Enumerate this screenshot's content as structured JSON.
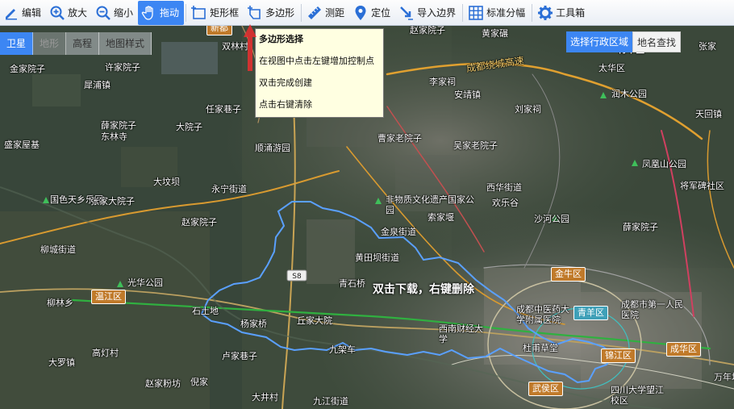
{
  "toolbar": {
    "items": [
      {
        "label": "编辑",
        "icon": "edit-icon"
      },
      {
        "label": "放大",
        "icon": "zoom-in-icon"
      },
      {
        "label": "缩小",
        "icon": "zoom-out-icon"
      },
      {
        "label": "拖动",
        "icon": "hand-icon",
        "active": true
      },
      {
        "label": "矩形框",
        "icon": "rectangle-icon"
      },
      {
        "label": "多边形",
        "icon": "polygon-icon"
      },
      {
        "label": "测距",
        "icon": "ruler-icon"
      },
      {
        "label": "定位",
        "icon": "location-pin-icon"
      },
      {
        "label": "导入边界",
        "icon": "import-boundary-icon"
      },
      {
        "label": "标准分幅",
        "icon": "grid-icon"
      },
      {
        "label": "工具箱",
        "icon": "gear-icon"
      }
    ]
  },
  "map_type": {
    "tabs": [
      {
        "label": "卫星",
        "selected": true
      },
      {
        "label": "地形",
        "disabled": true
      },
      {
        "label": "高程"
      },
      {
        "label": "地图样式"
      }
    ]
  },
  "region_tabs": {
    "select_region": "选择行政区域",
    "place_search": "地名查找"
  },
  "tooltip": {
    "title": "多边形选择",
    "lines": [
      "在视图中点击左键增加控制点",
      "双击完成创建",
      "点击右键清除"
    ]
  },
  "center_message": "双击下载，右键删除",
  "districts": {
    "wenjiang": "温江区",
    "jinniu": "金牛区",
    "qingyang": "青羊区",
    "jinjiang": "锦江区",
    "chenghua": "成华区",
    "wuhou": "武侯区",
    "xindu": "新都"
  },
  "places": {
    "jinjia_yuanzi": "金家院子",
    "xujia_yuanzi": "许家院子",
    "liliu": "犀浦镇",
    "xuejia_yuanzi": "薛家院子",
    "dongqiao": "东林寺",
    "dayuanzi": "大院子",
    "renjia_xiangzi": "任家巷子",
    "shuanglin": "双林村",
    "sheng": "盛家屋基",
    "anjing": "安靖镇",
    "shuncheng": "顺涌游园",
    "dabaoba": "大坟坝",
    "caojia": "曹家老院子",
    "lijiajia": "李家祠",
    "liujiaci": "刘家祠",
    "wujia": "吴家老院子",
    "huangjia": "黄家碾",
    "taiyang": "太华区",
    "runmu": "润木公园",
    "tianhui": "天回镇",
    "fenghuang": "凤凰山公园",
    "jiangjun": "将军碑社区",
    "guose": "国色天乡乐园",
    "zhangjia": "张家大院子",
    "yongning": "永宁街道",
    "feiwuzhi": "非物质文化遗产国家公园",
    "jinquan": "金泉街道",
    "suojia": "索家堰",
    "xihua": "西华街道",
    "huanle": "欢乐谷",
    "shahe": "沙河公园",
    "xuejiayuan": "薛家院子",
    "liucheng": "柳城街道",
    "guanghua": "光华公园",
    "huangtian": "黄田坝街道",
    "qingshi": "青石桥",
    "liulin": "柳林乡",
    "shitu": "石土地",
    "yangjia": "杨家桥",
    "qiujia": "丘家大院",
    "xinan": "西南财经大学",
    "zhonggong": "成都中医药大学附属医院",
    "renmin": "成都市第一人民医院",
    "dufu": "杜甫草堂",
    "jiujia": "九架车",
    "luojia": "卢家巷子",
    "dalu": "大罗镇",
    "gaodeng": "高灯村",
    "zhaojia": "赵家粉坊",
    "niyan": "倪家",
    "dajing": "大井村",
    "jiuqiao": "九江街道",
    "sichuan": "四川大学望江校区",
    "chengdu_ring": "成都绕城高速",
    "zhaojiayuan": "赵家院子",
    "zhang": "张家",
    "qingyang_top": "青羊区",
    "wanyuan": "万年场",
    "zhangjia_right": "张家"
  },
  "roads": {
    "s8": "S8"
  },
  "colors": {
    "accent": "#3c86f3",
    "tooltip_bg": "#ffffe1",
    "boundary": "#5aa0ff",
    "expressway": "#f0a020"
  }
}
